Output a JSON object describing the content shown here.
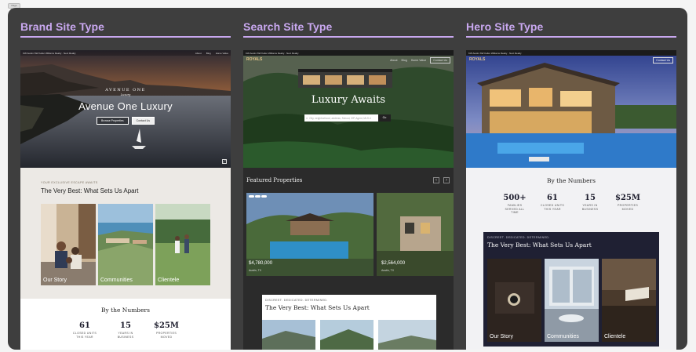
{
  "top_tag": "Page Frame",
  "columns": {
    "brand": {
      "title": "Brand Site Type",
      "nav": {
        "agent": "KW Austin SW Keller Williams Realty · Next Realty",
        "links": [
          "About",
          "Blog",
          "Home Value"
        ]
      },
      "hero": {
        "logo_line1": "AVENUE ONE",
        "logo_line2": "Luxury",
        "title": "Avenue One Luxury",
        "btn_browse": "Browse Properties",
        "btn_contact": "Contact Us"
      },
      "about": {
        "eyebrow": "YOUR EXCLUSIVE ESCAPE AWAITS",
        "heading": "The Very Best: What Sets Us Apart"
      },
      "cards": [
        "Our Story",
        "Communities",
        "Clientele"
      ],
      "numbers_title": "By the Numbers",
      "numbers": [
        {
          "value": "61",
          "label": "CLOSED UNITS THIS YEAR"
        },
        {
          "value": "15",
          "label": "YEARS IN BUSINESS"
        },
        {
          "value": "$25M",
          "label": "PROPERTIES MOVED"
        }
      ]
    },
    "search": {
      "title": "Search Site Type",
      "nav": {
        "agent": "KW Austin SW Keller Williams Realty · Next Realty",
        "brand": "ROYALS",
        "links": [
          "About",
          "Blog",
          "Home Value"
        ],
        "cta": "Contact Us"
      },
      "hero": {
        "title": "Luxury Awaits",
        "search_placeholder": "City, neighborhood, address, School, ZIP, Agent, MLS #",
        "search_button": "Go"
      },
      "featured_title": "Featured Properties",
      "listings": [
        {
          "price": "$4,780,000",
          "location": "Austin, TX"
        },
        {
          "price": "$2,564,000",
          "location": "Austin, TX"
        }
      ],
      "about": {
        "eyebrow": "DISCREET. DEDICATED. DETERMINED.",
        "heading": "The Very Best: What Sets Us Apart"
      }
    },
    "hero": {
      "title": "Hero Site Type",
      "nav": {
        "agent": "KW Austin SW Keller Williams Realty · Next Realty",
        "brand": "ROYALS",
        "cta": "Contact Us"
      },
      "numbers_title": "By the Numbers",
      "numbers": [
        {
          "value": "500+",
          "label": "FAMILIES SERVED ALL TIME"
        },
        {
          "value": "61",
          "label": "CLOSED UNITS THIS YEAR"
        },
        {
          "value": "15",
          "label": "YEARS IN BUSINESS"
        },
        {
          "value": "$25M",
          "label": "PROPERTIES MOVED"
        }
      ],
      "about": {
        "eyebrow": "DISCREET. DEDICATED. DETERMINED.",
        "heading": "The Very Best: What Sets Us Apart"
      },
      "cards": [
        "Our Story",
        "Communities",
        "Clientele"
      ]
    }
  },
  "colors": {
    "accent": "#c9a8f0",
    "board": "#3e3e3e",
    "navy": "#1f2033"
  }
}
